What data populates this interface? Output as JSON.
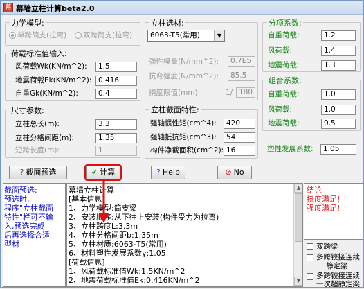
{
  "window": {
    "title": "幕墙立柱计算beta2.0",
    "icon_glyph": "幕"
  },
  "mechanics": {
    "title": "力学模型:",
    "single": "单跨简支(拉弯)",
    "double": "双跨简支(拉弯)"
  },
  "load": {
    "title": "荷载标准值输入:",
    "wind_label": "风荷载Wk(KN/m^2):",
    "wind_value": "1.5",
    "quake_label": "地震荷载Ek(KN/m^2):",
    "quake_value": "0.416",
    "self_label": "自重Gk(KN/m^2):",
    "self_value": "0.4"
  },
  "size": {
    "title": "尺寸参数:",
    "length_label": "立柱总长(m):",
    "length_value": "3.3",
    "spacing_label": "立柱分格间距(m):",
    "spacing_value": "1.35",
    "short_label": "短跨长度(m):",
    "short_value": "1"
  },
  "material": {
    "title": "立柱选材:",
    "selected": "6063-T5(常用)",
    "elastic_label": "弹性模量(N/mm^2):",
    "elastic_value": "0.7E5",
    "tensile_label": "抗弯强度(N/mm^2):",
    "tensile_value": "85.5",
    "deflect_label": "挠度限值(mm):",
    "deflect_sep": "1/",
    "deflect_value": "180"
  },
  "section": {
    "title": "立柱截面特性:",
    "inertia_label": "强轴惯性矩(cm^4):",
    "inertia_value": "420",
    "modulus_label": "强轴抵抗矩(cm^3):",
    "modulus_value": "54",
    "area_label": "构件净截面积(cm^2):",
    "area_value": "16"
  },
  "factors": {
    "title": "分项系数:",
    "self_label": "自重荷载:",
    "self_value": "1.2",
    "wind_label": "风荷载:",
    "wind_value": "1.4",
    "quake_label": "地震荷载:",
    "quake_value": "1.3"
  },
  "combo": {
    "title": "组合系数:",
    "self_label": "自重荷载:",
    "self_value": "1.0",
    "wind_label": "风荷载:",
    "wind_value": "1.0",
    "quake_label": "地震荷载:",
    "quake_value": "0.5"
  },
  "plastic": {
    "label": "塑性发展系数:",
    "value": "1.05"
  },
  "buttons": {
    "section": "截面预选",
    "calc": "计算",
    "help": "Help",
    "no": "No"
  },
  "left_note": [
    "截面预选:",
    "    预选时,",
    "程序\"立柱截面",
    "特性\"栏可不输",
    "入,预选完成",
    "后再选择合适",
    "型材"
  ],
  "result_lines": [
    "幕墙立柱计算",
    "[基本信息]",
    "1、力学模型:简支梁",
    "2、安装顺序:从下往上安装(构件受力为拉弯)",
    "3、立柱跨度L:3.3m",
    "4、立柱分格间距b:1.35m",
    "5、立柱材质:6063-T5(常用)",
    "6、材料塑性发展系数γ:1.05",
    "[荷载信息]",
    "1、风荷载标准值Wk:1.5KN/m^2",
    "2、地震荷载标准值Ek:0.416KN/m^2"
  ],
  "conclusion": {
    "title": "结论",
    "line1": "挠度满足!",
    "line2": "强度满足!"
  },
  "options": {
    "double": "双跨梁",
    "multi_static": "多跨铰接连续",
    "static": "静定梁",
    "multi_super": "多跨铰接连续",
    "super": "一次超静定梁"
  },
  "colors": {
    "accent_red": "#e01010",
    "note_blue": "#1010d0"
  }
}
